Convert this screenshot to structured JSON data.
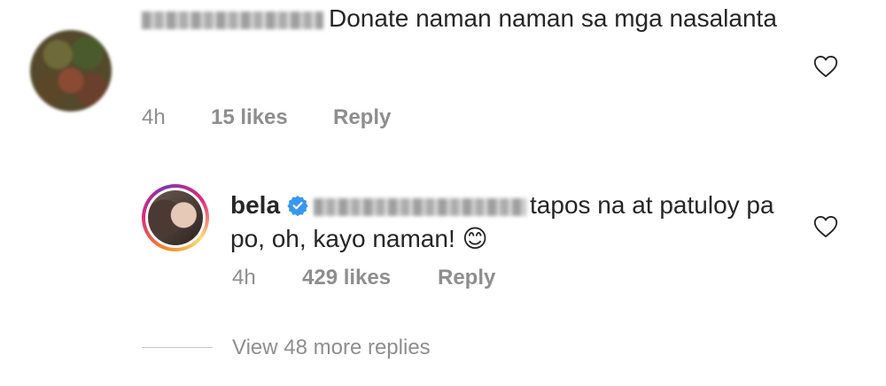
{
  "comment": {
    "text": "Donate naman naman sa mga nasalanta",
    "time": "4h",
    "likes": "15 likes",
    "reply_label": "Reply"
  },
  "reply": {
    "username": "bela",
    "text": "tapos na at patuloy pa po, oh, kayo naman! 😊",
    "time": "4h",
    "likes": "429 likes",
    "reply_label": "Reply"
  },
  "view_more": "View 48 more replies",
  "icons": {
    "like": "heart-outline-icon",
    "verified": "verified-badge-icon"
  },
  "colors": {
    "text": "#262626",
    "secondary": "#8e8e8e",
    "verified": "#3897f0"
  }
}
